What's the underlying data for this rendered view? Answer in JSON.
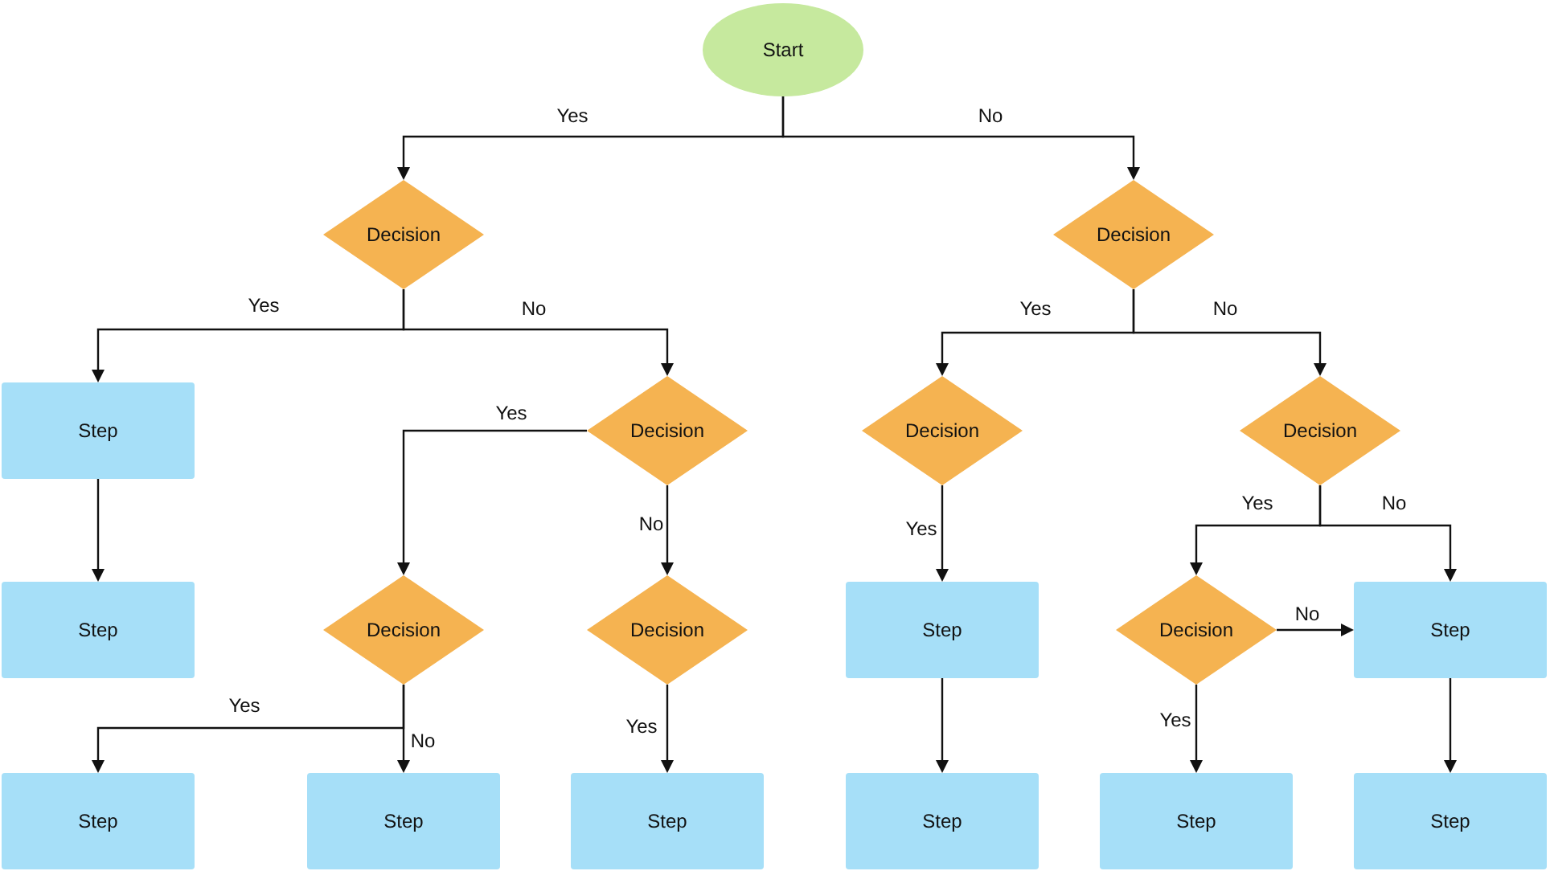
{
  "flowchart": {
    "nodes": [
      {
        "kind": "start",
        "label": "Start"
      },
      {
        "kind": "decision",
        "label": "Decision"
      },
      {
        "kind": "decision",
        "label": "Decision"
      },
      {
        "kind": "step",
        "label": "Step"
      },
      {
        "kind": "decision",
        "label": "Decision"
      },
      {
        "kind": "decision",
        "label": "Decision"
      },
      {
        "kind": "decision",
        "label": "Decision"
      },
      {
        "kind": "step",
        "label": "Step"
      },
      {
        "kind": "decision",
        "label": "Decision"
      },
      {
        "kind": "decision",
        "label": "Decision"
      },
      {
        "kind": "step",
        "label": "Step"
      },
      {
        "kind": "decision",
        "label": "Decision"
      },
      {
        "kind": "step",
        "label": "Step"
      },
      {
        "kind": "step",
        "label": "Step"
      },
      {
        "kind": "step",
        "label": "Step"
      },
      {
        "kind": "step",
        "label": "Step"
      },
      {
        "kind": "step",
        "label": "Step"
      },
      {
        "kind": "step",
        "label": "Step"
      },
      {
        "kind": "step",
        "label": "Step"
      }
    ],
    "edge_labels": [
      {
        "text": "Yes"
      },
      {
        "text": "No"
      },
      {
        "text": "Yes"
      },
      {
        "text": "No"
      },
      {
        "text": "Yes"
      },
      {
        "text": "No"
      },
      {
        "text": "Yes"
      },
      {
        "text": "No"
      },
      {
        "text": "Yes"
      },
      {
        "text": "Yes"
      },
      {
        "text": "No"
      },
      {
        "text": "No"
      },
      {
        "text": "Yes"
      },
      {
        "text": "No"
      },
      {
        "text": "Yes"
      },
      {
        "text": "Yes"
      }
    ]
  }
}
